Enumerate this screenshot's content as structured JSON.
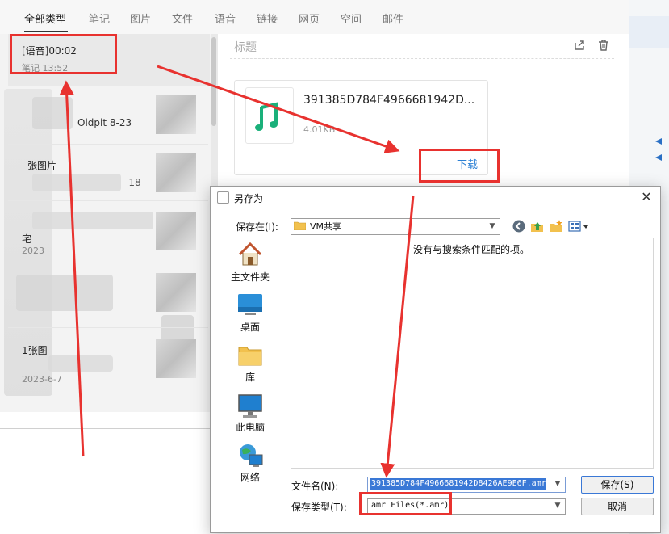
{
  "app": {
    "tabs": [
      {
        "label": "全部类型",
        "active": true
      },
      {
        "label": "笔记"
      },
      {
        "label": "图片"
      },
      {
        "label": "文件"
      },
      {
        "label": "语音"
      },
      {
        "label": "链接"
      },
      {
        "label": "网页"
      },
      {
        "label": "空间"
      },
      {
        "label": "邮件"
      }
    ],
    "notes": [
      {
        "title": "[语音]00:02",
        "subtitle": "笔记 13:52"
      },
      {
        "title": "_Oldpit 8-23",
        "subtitle": ""
      },
      {
        "title": "张图片",
        "subtitle": "-18"
      },
      {
        "title": "宅",
        "subtitle": "2023"
      },
      {
        "title": "",
        "subtitle": ""
      },
      {
        "title": "1张图",
        "subtitle": "2023-6-7"
      }
    ],
    "detail": {
      "title_placeholder": "标题",
      "attachment_name": "391385D784F4966681942D...",
      "attachment_size": "4.01KB",
      "download_label": "下载"
    }
  },
  "dialog": {
    "title": "另存为",
    "close": "✕",
    "save_in_label": "保存在(I):",
    "save_in_value": "VM共享",
    "empty_message": "没有与搜索条件匹配的项。",
    "places": [
      "主文件夹",
      "桌面",
      "库",
      "此电脑",
      "网络"
    ],
    "filename_label": "文件名(N):",
    "filename_value": "391385D784F4966681942D8426AE9E6F.amr",
    "filetype_label": "保存类型(T):",
    "filetype_value": "amr Files(*.amr)",
    "save_button": "保存(S)",
    "cancel_button": "取消"
  },
  "colors": {
    "annotation_red": "#e8322f",
    "link_blue": "#2a7fd4",
    "selection_blue": "#3a78d6",
    "music_green": "#1ab07a"
  }
}
